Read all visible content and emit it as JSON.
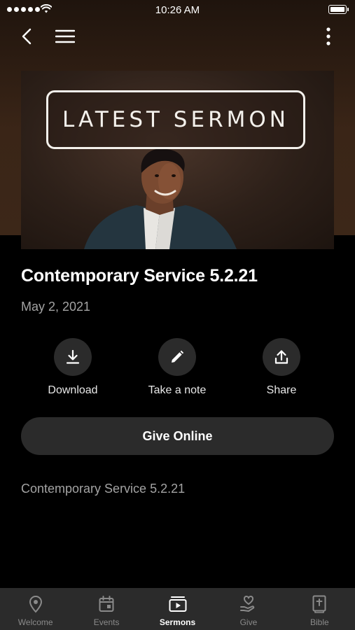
{
  "status_bar": {
    "time": "10:26 AM"
  },
  "hero": {
    "badge_text": "LATEST SERMON"
  },
  "sermon": {
    "title": "Contemporary Service 5.2.21",
    "date": "May 2, 2021",
    "description": "Contemporary Service 5.2.21"
  },
  "actions": {
    "download": "Download",
    "note": "Take a note",
    "share": "Share"
  },
  "give_button": "Give Online",
  "tabs": [
    {
      "label": "Welcome",
      "icon": "location-pin-icon"
    },
    {
      "label": "Events",
      "icon": "calendar-icon"
    },
    {
      "label": "Sermons",
      "icon": "play-media-icon",
      "active": true
    },
    {
      "label": "Give",
      "icon": "heart-hand-icon"
    },
    {
      "label": "Bible",
      "icon": "bible-icon"
    }
  ],
  "colors": {
    "background": "#000000",
    "header_brown": "#3a2517",
    "surface": "#2b2b2b",
    "muted_text": "#a3a3a3"
  }
}
